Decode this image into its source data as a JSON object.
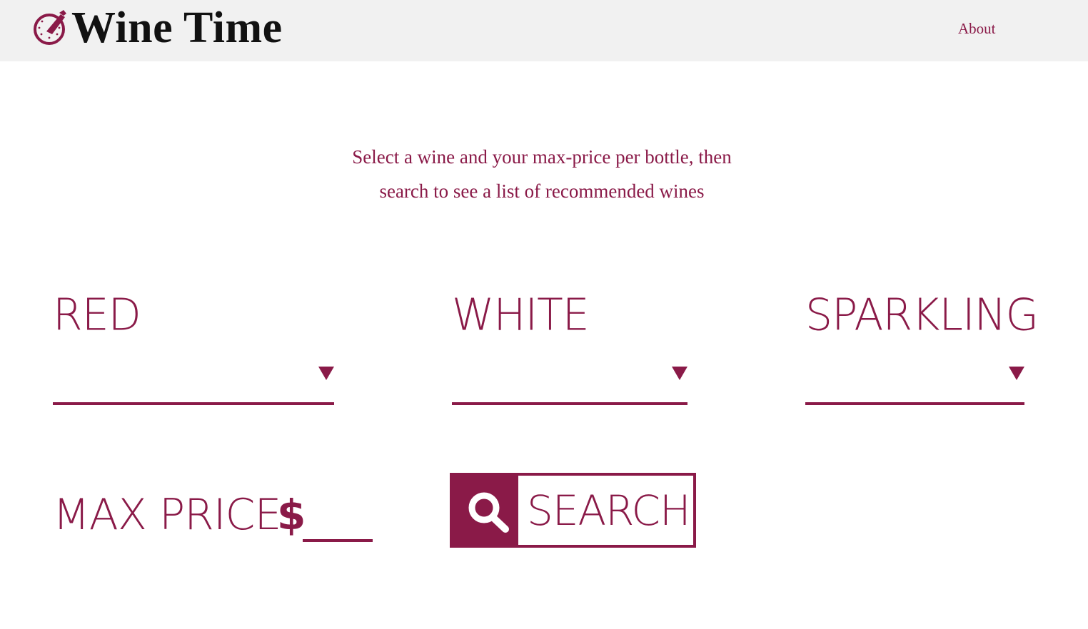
{
  "header": {
    "brand": "Wine Time",
    "logo_icon": "wine-clock-icon",
    "nav": [
      {
        "label": "About"
      }
    ]
  },
  "intro": {
    "line1": "Select a wine and your max-price per bottle, then",
    "line2": "search to see a list of recommended wines"
  },
  "wine_types": [
    {
      "label": "RED",
      "selected": ""
    },
    {
      "label": "WHITE",
      "selected": ""
    },
    {
      "label": "SPARKLING",
      "selected": ""
    }
  ],
  "price": {
    "label": "MAX PRICE",
    "currency": "$",
    "value": ""
  },
  "search": {
    "label": "SEARCH",
    "icon": "search-icon"
  },
  "colors": {
    "accent": "#8a1a48",
    "header_bg": "#f1f1f1",
    "brand_text": "#111111"
  }
}
